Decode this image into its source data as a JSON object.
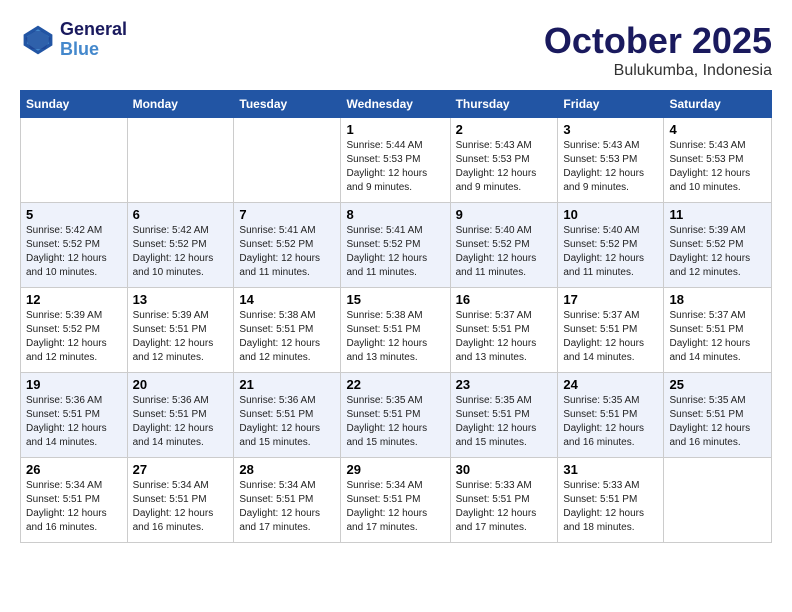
{
  "header": {
    "logo_line1": "General",
    "logo_line2": "Blue",
    "month": "October 2025",
    "location": "Bulukumba, Indonesia"
  },
  "weekdays": [
    "Sunday",
    "Monday",
    "Tuesday",
    "Wednesday",
    "Thursday",
    "Friday",
    "Saturday"
  ],
  "weeks": [
    [
      {
        "day": "",
        "info": ""
      },
      {
        "day": "",
        "info": ""
      },
      {
        "day": "",
        "info": ""
      },
      {
        "day": "1",
        "info": "Sunrise: 5:44 AM\nSunset: 5:53 PM\nDaylight: 12 hours and 9 minutes."
      },
      {
        "day": "2",
        "info": "Sunrise: 5:43 AM\nSunset: 5:53 PM\nDaylight: 12 hours and 9 minutes."
      },
      {
        "day": "3",
        "info": "Sunrise: 5:43 AM\nSunset: 5:53 PM\nDaylight: 12 hours and 9 minutes."
      },
      {
        "day": "4",
        "info": "Sunrise: 5:43 AM\nSunset: 5:53 PM\nDaylight: 12 hours and 10 minutes."
      }
    ],
    [
      {
        "day": "5",
        "info": "Sunrise: 5:42 AM\nSunset: 5:52 PM\nDaylight: 12 hours and 10 minutes."
      },
      {
        "day": "6",
        "info": "Sunrise: 5:42 AM\nSunset: 5:52 PM\nDaylight: 12 hours and 10 minutes."
      },
      {
        "day": "7",
        "info": "Sunrise: 5:41 AM\nSunset: 5:52 PM\nDaylight: 12 hours and 11 minutes."
      },
      {
        "day": "8",
        "info": "Sunrise: 5:41 AM\nSunset: 5:52 PM\nDaylight: 12 hours and 11 minutes."
      },
      {
        "day": "9",
        "info": "Sunrise: 5:40 AM\nSunset: 5:52 PM\nDaylight: 12 hours and 11 minutes."
      },
      {
        "day": "10",
        "info": "Sunrise: 5:40 AM\nSunset: 5:52 PM\nDaylight: 12 hours and 11 minutes."
      },
      {
        "day": "11",
        "info": "Sunrise: 5:39 AM\nSunset: 5:52 PM\nDaylight: 12 hours and 12 minutes."
      }
    ],
    [
      {
        "day": "12",
        "info": "Sunrise: 5:39 AM\nSunset: 5:52 PM\nDaylight: 12 hours and 12 minutes."
      },
      {
        "day": "13",
        "info": "Sunrise: 5:39 AM\nSunset: 5:51 PM\nDaylight: 12 hours and 12 minutes."
      },
      {
        "day": "14",
        "info": "Sunrise: 5:38 AM\nSunset: 5:51 PM\nDaylight: 12 hours and 12 minutes."
      },
      {
        "day": "15",
        "info": "Sunrise: 5:38 AM\nSunset: 5:51 PM\nDaylight: 12 hours and 13 minutes."
      },
      {
        "day": "16",
        "info": "Sunrise: 5:37 AM\nSunset: 5:51 PM\nDaylight: 12 hours and 13 minutes."
      },
      {
        "day": "17",
        "info": "Sunrise: 5:37 AM\nSunset: 5:51 PM\nDaylight: 12 hours and 14 minutes."
      },
      {
        "day": "18",
        "info": "Sunrise: 5:37 AM\nSunset: 5:51 PM\nDaylight: 12 hours and 14 minutes."
      }
    ],
    [
      {
        "day": "19",
        "info": "Sunrise: 5:36 AM\nSunset: 5:51 PM\nDaylight: 12 hours and 14 minutes."
      },
      {
        "day": "20",
        "info": "Sunrise: 5:36 AM\nSunset: 5:51 PM\nDaylight: 12 hours and 14 minutes."
      },
      {
        "day": "21",
        "info": "Sunrise: 5:36 AM\nSunset: 5:51 PM\nDaylight: 12 hours and 15 minutes."
      },
      {
        "day": "22",
        "info": "Sunrise: 5:35 AM\nSunset: 5:51 PM\nDaylight: 12 hours and 15 minutes."
      },
      {
        "day": "23",
        "info": "Sunrise: 5:35 AM\nSunset: 5:51 PM\nDaylight: 12 hours and 15 minutes."
      },
      {
        "day": "24",
        "info": "Sunrise: 5:35 AM\nSunset: 5:51 PM\nDaylight: 12 hours and 16 minutes."
      },
      {
        "day": "25",
        "info": "Sunrise: 5:35 AM\nSunset: 5:51 PM\nDaylight: 12 hours and 16 minutes."
      }
    ],
    [
      {
        "day": "26",
        "info": "Sunrise: 5:34 AM\nSunset: 5:51 PM\nDaylight: 12 hours and 16 minutes."
      },
      {
        "day": "27",
        "info": "Sunrise: 5:34 AM\nSunset: 5:51 PM\nDaylight: 12 hours and 16 minutes."
      },
      {
        "day": "28",
        "info": "Sunrise: 5:34 AM\nSunset: 5:51 PM\nDaylight: 12 hours and 17 minutes."
      },
      {
        "day": "29",
        "info": "Sunrise: 5:34 AM\nSunset: 5:51 PM\nDaylight: 12 hours and 17 minutes."
      },
      {
        "day": "30",
        "info": "Sunrise: 5:33 AM\nSunset: 5:51 PM\nDaylight: 12 hours and 17 minutes."
      },
      {
        "day": "31",
        "info": "Sunrise: 5:33 AM\nSunset: 5:51 PM\nDaylight: 12 hours and 18 minutes."
      },
      {
        "day": "",
        "info": ""
      }
    ]
  ]
}
